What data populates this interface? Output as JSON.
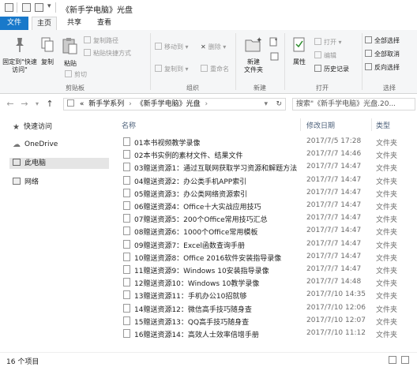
{
  "window": {
    "title": "《新手学电脑》光盘"
  },
  "ribbon_tabs": [
    {
      "label": "文件",
      "active": false
    },
    {
      "label": "主页",
      "active": true
    },
    {
      "label": "共享",
      "active": false
    },
    {
      "label": "查看",
      "active": false
    }
  ],
  "ribbon": {
    "clipboard": {
      "pin_label": "固定到\"快速访问\"",
      "copy_label": "复制",
      "paste_label": "粘贴",
      "copy_path_label": "复制路径",
      "paste_shortcut_label": "粘贴快捷方式",
      "cut_label": "剪切",
      "group_label": "剪贴板"
    },
    "organize": {
      "move_to_label": "移动到",
      "copy_to_label": "复制到",
      "delete_label": "删除",
      "rename_label": "重命名",
      "group_label": "组织"
    },
    "new": {
      "new_folder_label": "新建\n文件夹",
      "group_label": "新建"
    },
    "open": {
      "properties_label": "属性",
      "open_label": "打开",
      "edit_label": "编辑",
      "history_label": "历史记录",
      "group_label": "打开"
    },
    "select": {
      "select_all_label": "全部选择",
      "select_none_label": "全部取消",
      "invert_label": "反向选择",
      "group_label": "选择"
    }
  },
  "address": {
    "prefix": "«",
    "crumbs": [
      "新手学系列",
      "《新手学电脑》光盘"
    ],
    "search_placeholder": "搜索\"《新手学电脑》光盘.20..."
  },
  "nav_pane": [
    {
      "label": "快速访问",
      "icon": "star-icon"
    },
    {
      "label": "OneDrive",
      "icon": "cloud-icon"
    },
    {
      "label": "此电脑",
      "icon": "computer-icon"
    },
    {
      "label": "网络",
      "icon": "network-icon"
    }
  ],
  "columns": {
    "name": "名称",
    "modified": "修改日期",
    "type": "类型"
  },
  "files": [
    {
      "name": "01本书视频教学录像",
      "date": "2017/7/5 17:28",
      "type": "文件夹"
    },
    {
      "name": "02本书实例的素材文件、结果文件",
      "date": "2017/7/7 14:46",
      "type": "文件夹"
    },
    {
      "name": "03赠送资源1：通过互联网获取学习资源和解题方法",
      "date": "2017/7/7 14:47",
      "type": "文件夹"
    },
    {
      "name": "04赠送资源2：办公类手机APP索引",
      "date": "2017/7/7 14:47",
      "type": "文件夹"
    },
    {
      "name": "05赠送资源3：办公类网络资源索引",
      "date": "2017/7/7 14:47",
      "type": "文件夹"
    },
    {
      "name": "06赠送资源4：Office十大实战应用技巧",
      "date": "2017/7/7 14:47",
      "type": "文件夹"
    },
    {
      "name": "07赠送资源5：200个Office常用技巧汇总",
      "date": "2017/7/7 14:47",
      "type": "文件夹"
    },
    {
      "name": "08赠送资源6：1000个Office常用模板",
      "date": "2017/7/7 14:47",
      "type": "文件夹"
    },
    {
      "name": "09赠送资源7：Excel函数查询手册",
      "date": "2017/7/7 14:47",
      "type": "文件夹"
    },
    {
      "name": "10赠送资源8：Office 2016软件安装指导录像",
      "date": "2017/7/7 14:47",
      "type": "文件夹"
    },
    {
      "name": "11赠送资源9：Windows 10安装指导录像",
      "date": "2017/7/7 14:47",
      "type": "文件夹"
    },
    {
      "name": "12赠送资源10：Windows 10教学录像",
      "date": "2017/7/7 14:48",
      "type": "文件夹"
    },
    {
      "name": "13赠送资源11：手机办公10招就够",
      "date": "2017/7/10 14:35",
      "type": "文件夹"
    },
    {
      "name": "14赠送资源12：微信高手技巧随身查",
      "date": "2017/7/10 12:06",
      "type": "文件夹"
    },
    {
      "name": "15赠送资源13：QQ高手技巧随身查",
      "date": "2017/7/10 12:07",
      "type": "文件夹"
    },
    {
      "name": "16赠送资源14：高效人士效率倍增手册",
      "date": "2017/7/10 11:12",
      "type": "文件夹"
    }
  ],
  "status": {
    "item_count": "16 个项目"
  },
  "colors": {
    "file_tab": "#1979ca",
    "ribbon_bg": "#f5f6f7",
    "selected_nav": "#e5e5e5"
  }
}
